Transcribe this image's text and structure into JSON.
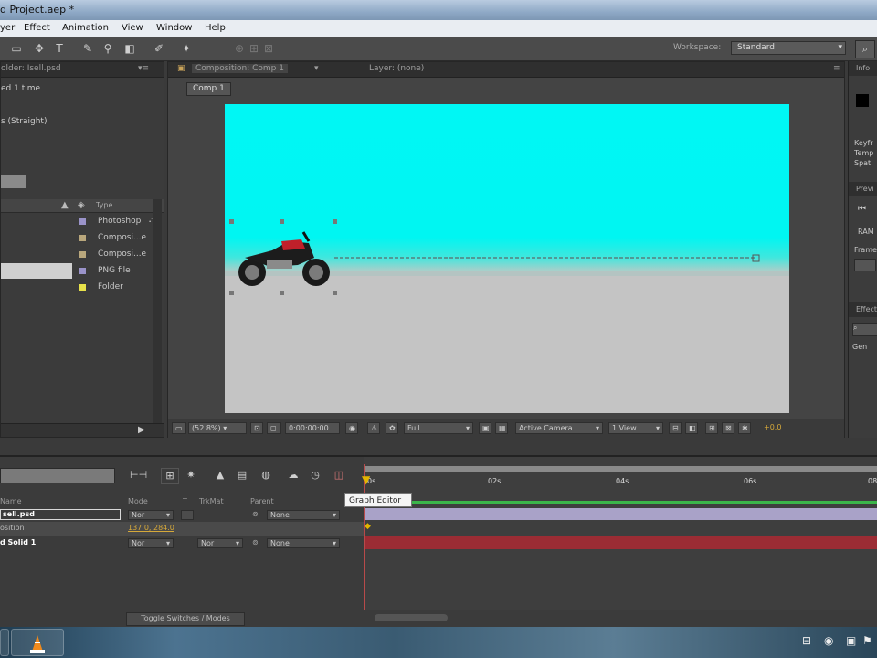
{
  "window": {
    "title": "d Project.aep *"
  },
  "menu": [
    "yer",
    "Effect",
    "Animation",
    "View",
    "Window",
    "Help"
  ],
  "toolbar": {
    "workspace_label": "Workspace:",
    "workspace_value": "Standard"
  },
  "project_panel": {
    "tab": "older: Isell.psd",
    "info_line1": "ed 1 time",
    "info_line2": "s (Straight)",
    "type_header": "Type",
    "rows": [
      {
        "type": "Photoshop",
        "color": "#9a93c9"
      },
      {
        "type": "Composi...e",
        "color": "#b9a77c"
      },
      {
        "type": "Composi...e",
        "color": "#b9a77c"
      },
      {
        "type": "PNG file",
        "color": "#9a93c9"
      },
      {
        "type": "Folder",
        "color": "#e8e24a"
      }
    ]
  },
  "composition": {
    "tab_comp": "Composition: Comp 1",
    "tab_layer": "Layer: (none)",
    "flow_label": "Comp 1",
    "zoom": "(52.8%)",
    "timecode": "0:00:00:00",
    "resolution": "Full",
    "camera": "Active Camera",
    "views": "1 View",
    "exposure": "+0.0"
  },
  "info_panel": {
    "tab": "Info",
    "lines": [
      "Keyfr",
      "Temp",
      "Spati"
    ]
  },
  "preview_panel": {
    "tab": "Previ",
    "ram": "RAM",
    "fram": "Frame"
  },
  "effects_panel": {
    "tab": "Effect",
    "gen": "Gen"
  },
  "timeline": {
    "col_name": "Name",
    "col_mode": "Mode",
    "col_t": "T",
    "col_trkmat": "TrkMat",
    "col_parent": "Parent",
    "layers": [
      {
        "name": "sell.psd",
        "mode": "Nor",
        "trkmat": "",
        "parent": "None"
      },
      {
        "name": "osition",
        "value": "137.0, 284.0"
      },
      {
        "name": "d Solid 1",
        "mode": "Nor",
        "trkmat": "Nor",
        "parent": "None"
      }
    ],
    "ruler": [
      "0s",
      "02s",
      "04s",
      "06s",
      "08"
    ],
    "tooltip": "Graph Editor",
    "toggle_label": "Toggle Switches / Modes"
  }
}
